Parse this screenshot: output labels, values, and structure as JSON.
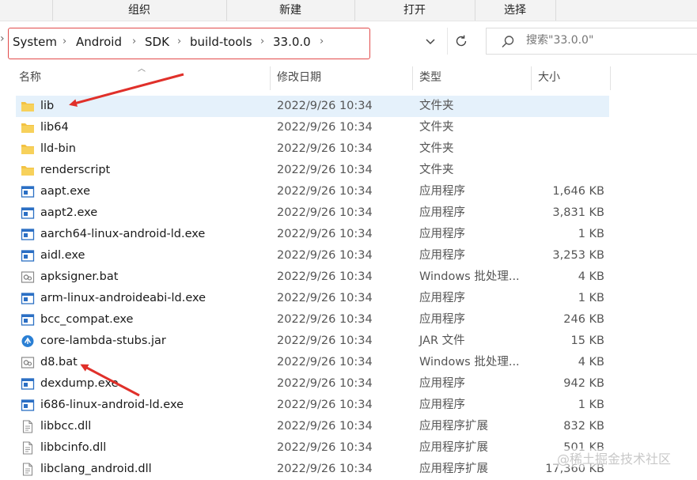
{
  "ribbon": {
    "items": [
      "组织",
      "新建",
      "打开",
      "选择"
    ]
  },
  "address": {
    "crumbs": [
      "System",
      "Android",
      "SDK",
      "build-tools",
      "33.0.0"
    ]
  },
  "search": {
    "placeholder": "搜索\"33.0.0\""
  },
  "columns": {
    "name": "名称",
    "date": "修改日期",
    "type": "类型",
    "size": "大小"
  },
  "files": [
    {
      "name": "lib",
      "date": "2022/9/26 10:34",
      "type": "文件夹",
      "size": "",
      "icon": "folder-icon",
      "selected": true
    },
    {
      "name": "lib64",
      "date": "2022/9/26 10:34",
      "type": "文件夹",
      "size": "",
      "icon": "folder-icon"
    },
    {
      "name": "lld-bin",
      "date": "2022/9/26 10:34",
      "type": "文件夹",
      "size": "",
      "icon": "folder-icon"
    },
    {
      "name": "renderscript",
      "date": "2022/9/26 10:34",
      "type": "文件夹",
      "size": "",
      "icon": "folder-icon"
    },
    {
      "name": "aapt.exe",
      "date": "2022/9/26 10:34",
      "type": "应用程序",
      "size": "1,646 KB",
      "icon": "exe-icon"
    },
    {
      "name": "aapt2.exe",
      "date": "2022/9/26 10:34",
      "type": "应用程序",
      "size": "3,831 KB",
      "icon": "exe-icon"
    },
    {
      "name": "aarch64-linux-android-ld.exe",
      "date": "2022/9/26 10:34",
      "type": "应用程序",
      "size": "1 KB",
      "icon": "exe-icon"
    },
    {
      "name": "aidl.exe",
      "date": "2022/9/26 10:34",
      "type": "应用程序",
      "size": "3,253 KB",
      "icon": "exe-icon"
    },
    {
      "name": "apksigner.bat",
      "date": "2022/9/26 10:34",
      "type": "Windows 批处理...",
      "size": "4 KB",
      "icon": "bat-icon"
    },
    {
      "name": "arm-linux-androideabi-ld.exe",
      "date": "2022/9/26 10:34",
      "type": "应用程序",
      "size": "1 KB",
      "icon": "exe-icon"
    },
    {
      "name": "bcc_compat.exe",
      "date": "2022/9/26 10:34",
      "type": "应用程序",
      "size": "246 KB",
      "icon": "exe-icon"
    },
    {
      "name": "core-lambda-stubs.jar",
      "date": "2022/9/26 10:34",
      "type": "JAR 文件",
      "size": "15 KB",
      "icon": "jar-icon"
    },
    {
      "name": "d8.bat",
      "date": "2022/9/26 10:34",
      "type": "Windows 批处理...",
      "size": "4 KB",
      "icon": "bat-icon"
    },
    {
      "name": "dexdump.exe",
      "date": "2022/9/26 10:34",
      "type": "应用程序",
      "size": "942 KB",
      "icon": "exe-icon"
    },
    {
      "name": "i686-linux-android-ld.exe",
      "date": "2022/9/26 10:34",
      "type": "应用程序",
      "size": "1 KB",
      "icon": "exe-icon"
    },
    {
      "name": "libbcc.dll",
      "date": "2022/9/26 10:34",
      "type": "应用程序扩展",
      "size": "832 KB",
      "icon": "dll-icon"
    },
    {
      "name": "libbcinfo.dll",
      "date": "2022/9/26 10:34",
      "type": "应用程序扩展",
      "size": "501 KB",
      "icon": "dll-icon"
    },
    {
      "name": "libclang_android.dll",
      "date": "2022/9/26 10:34",
      "type": "应用程序扩展",
      "size": "17,360 KB",
      "icon": "dll-icon"
    }
  ],
  "watermark": "@稀土掘金技术社区",
  "colors": {
    "highlight_border": "#e24a4a",
    "arrow": "#e0302a",
    "selected_row": "#e5f1fb",
    "folder": "#f3c243",
    "exe": "#2b6fc4",
    "jar": "#2a7fd4"
  }
}
